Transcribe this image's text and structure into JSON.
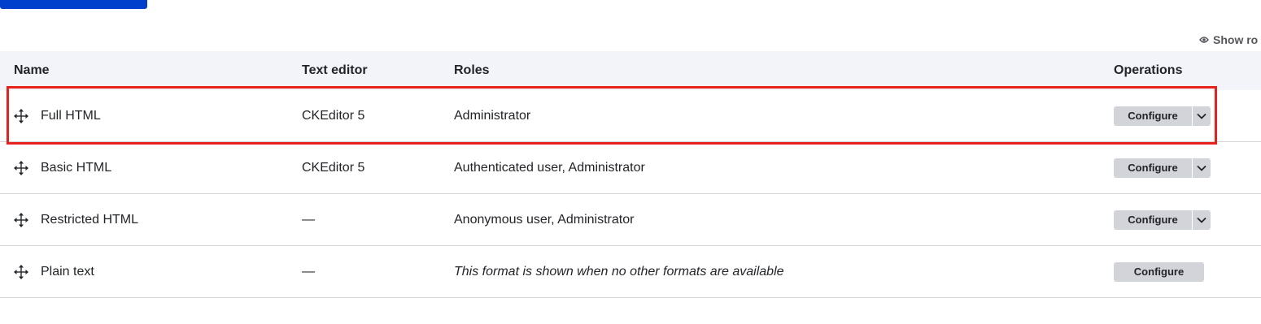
{
  "show_row_weights": {
    "label": "Show ro"
  },
  "table": {
    "headers": {
      "name": "Name",
      "editor": "Text editor",
      "roles": "Roles",
      "operations": "Operations"
    },
    "rows": [
      {
        "name": "Full HTML",
        "editor": "CKEditor 5",
        "roles": "Administrator",
        "operation": "Configure",
        "has_dropdown": true
      },
      {
        "name": "Basic HTML",
        "editor": "CKEditor 5",
        "roles": "Authenticated user, Administrator",
        "operation": "Configure",
        "has_dropdown": true
      },
      {
        "name": "Restricted HTML",
        "editor": "—",
        "roles": "Anonymous user, Administrator",
        "operation": "Configure",
        "has_dropdown": true
      },
      {
        "name": "Plain text",
        "editor": "—",
        "roles": "This format is shown when no other formats are available",
        "operation": "Configure",
        "has_dropdown": false
      }
    ]
  },
  "colors": {
    "primary": "#003ecc",
    "header_bg": "#f3f4f9",
    "button_bg": "#d3d4d9",
    "highlight": "#e8221b"
  },
  "icons": {
    "drag": "move-arrows-icon",
    "eye": "eye-icon",
    "dropdown": "chevron-down-icon"
  }
}
